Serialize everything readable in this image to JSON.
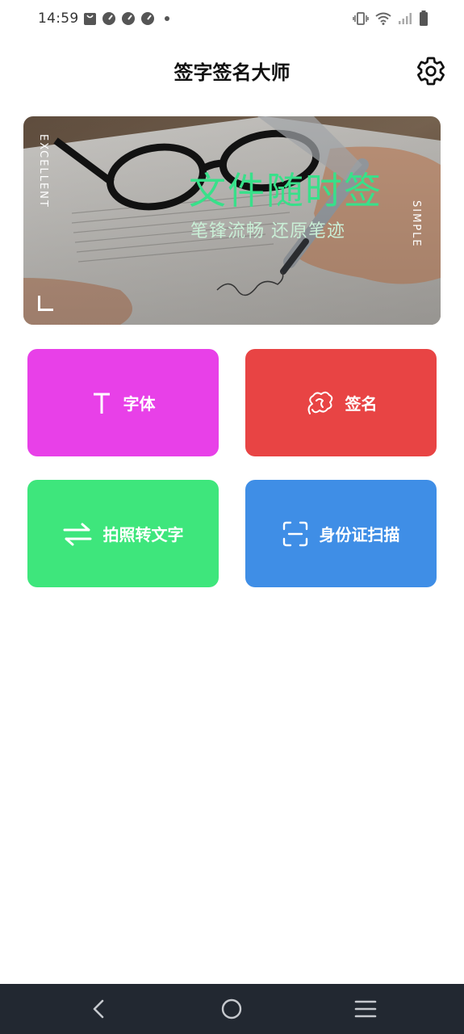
{
  "status_bar": {
    "time": "14:59",
    "left_icons": [
      "bag-notification-icon",
      "speedometer-icon",
      "speedometer-icon",
      "speedometer-icon",
      "more-dot-icon"
    ],
    "right_icons": [
      "vibrate-icon",
      "wifi-icon",
      "signal-icon",
      "battery-icon"
    ]
  },
  "header": {
    "title": "签字签名大师",
    "settings_icon": "gear-icon"
  },
  "banner": {
    "title": "文件随时签",
    "subtitle": "笔锋流畅  还原笔迹",
    "left_vertical_text": "EXCELLENT",
    "right_vertical_text": "SIMPLE"
  },
  "tiles": [
    {
      "label": "字体",
      "icon": "text-t-icon",
      "color": "#e840e8"
    },
    {
      "label": "签名",
      "icon": "signature-scribble-icon",
      "color": "#e84444"
    },
    {
      "label": "拍照转文字",
      "icon": "swap-arrows-icon",
      "color": "#3ee67c"
    },
    {
      "label": "身份证扫描",
      "icon": "scan-frame-icon",
      "color": "#3f8ee6"
    }
  ],
  "nav": {
    "back_icon": "back-chevron-icon",
    "home_icon": "home-circle-icon",
    "menu_icon": "menu-lines-icon",
    "background": "#222831"
  },
  "colors": {
    "banner_title": "#38e08a",
    "banner_subtitle": "#c9efd6"
  }
}
